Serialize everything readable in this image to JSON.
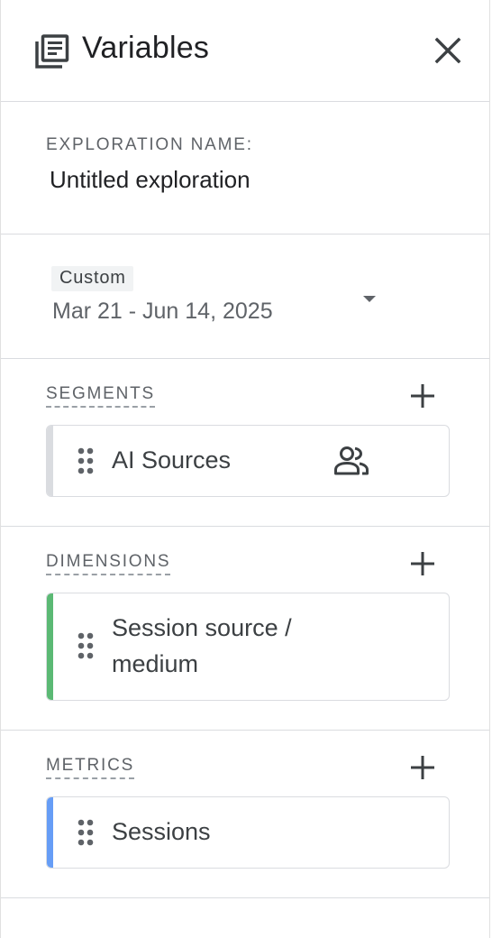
{
  "header": {
    "title": "Variables",
    "panel_icon": "library-books-icon",
    "close_icon": "close-icon"
  },
  "exploration": {
    "label": "EXPLORATION NAME:",
    "name": "Untitled exploration"
  },
  "date_range": {
    "chip": "Custom",
    "range": "Mar 21 - Jun 14, 2025",
    "dropdown_icon": "arrow-drop-down-icon"
  },
  "segments": {
    "title": "SEGMENTS",
    "add_icon": "plus-icon",
    "items": [
      {
        "label": "AI Sources",
        "icon": "people-icon"
      }
    ]
  },
  "dimensions": {
    "title": "DIMENSIONS",
    "add_icon": "plus-icon",
    "items": [
      {
        "label": "Session source / medium"
      }
    ]
  },
  "metrics": {
    "title": "METRICS",
    "add_icon": "plus-icon",
    "items": [
      {
        "label": "Sessions"
      }
    ]
  },
  "colors": {
    "segment_accent": "#dadce0",
    "dimension_accent": "#5bb974",
    "metric_accent": "#669df6",
    "text": "#3c4043",
    "muted": "#5f6368"
  }
}
